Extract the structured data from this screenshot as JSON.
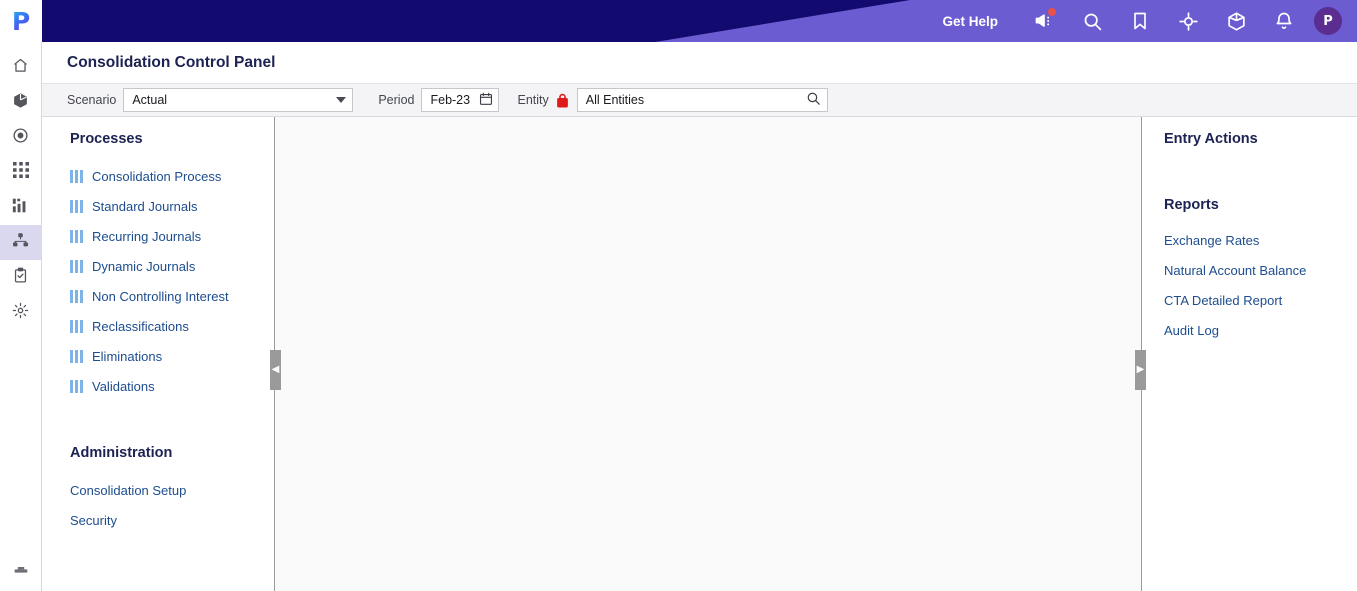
{
  "header": {
    "logo_text": "P",
    "get_help": "Get Help",
    "icons": [
      {
        "name": "megaphone-icon",
        "has_badge": true
      },
      {
        "name": "search-icon",
        "has_badge": false
      },
      {
        "name": "bookmark-icon",
        "has_badge": false
      },
      {
        "name": "target-icon",
        "has_badge": false
      },
      {
        "name": "cube-icon",
        "has_badge": false
      },
      {
        "name": "bell-icon",
        "has_badge": false
      }
    ],
    "avatar_initial": "P",
    "navy_color": "#120a6e",
    "purple_color": "#6b5cd1",
    "avatar_color": "#5b2d91",
    "badge_color": "#e8524a"
  },
  "rail": {
    "items": [
      {
        "icon": "home-icon",
        "active": false
      },
      {
        "icon": "cube-icon",
        "active": false
      },
      {
        "icon": "target-icon",
        "active": false
      },
      {
        "icon": "grid-icon",
        "active": false
      },
      {
        "icon": "bar-chart-icon",
        "active": false
      },
      {
        "icon": "hierarchy-icon",
        "active": true
      },
      {
        "icon": "clipboard-icon",
        "active": false
      },
      {
        "icon": "gear-icon",
        "active": false
      }
    ],
    "active_background": "#d9d8ef"
  },
  "page": {
    "title": "Consolidation Control Panel"
  },
  "filters": {
    "scenario_label": "Scenario",
    "scenario_value": "Actual",
    "period_label": "Period",
    "period_value": "Feb-23",
    "entity_label": "Entity",
    "entity_value": "All Entities",
    "entity_locked": true,
    "lock_color": "#e01b1b"
  },
  "left_panel": {
    "processes_heading": "Processes",
    "processes": [
      {
        "label": "Consolidation Process"
      },
      {
        "label": "Standard Journals"
      },
      {
        "label": "Recurring Journals"
      },
      {
        "label": "Dynamic Journals"
      },
      {
        "label": "Non Controlling Interest"
      },
      {
        "label": "Reclassifications"
      },
      {
        "label": "Eliminations"
      },
      {
        "label": "Validations"
      }
    ],
    "administration_heading": "Administration",
    "administration": [
      {
        "label": "Consolidation Setup"
      },
      {
        "label": "Security"
      }
    ],
    "link_color": "#1d4d8f",
    "bar_icon_color": "#7eb3e8"
  },
  "right_panel": {
    "entry_actions_heading": "Entry Actions",
    "reports_heading": "Reports",
    "reports": [
      {
        "label": "Exchange Rates"
      },
      {
        "label": "Natural Account Balance"
      },
      {
        "label": "CTA Detailed Report"
      },
      {
        "label": "Audit Log"
      }
    ]
  },
  "handles": {
    "left_glyph": "◀",
    "right_glyph": "▶"
  }
}
